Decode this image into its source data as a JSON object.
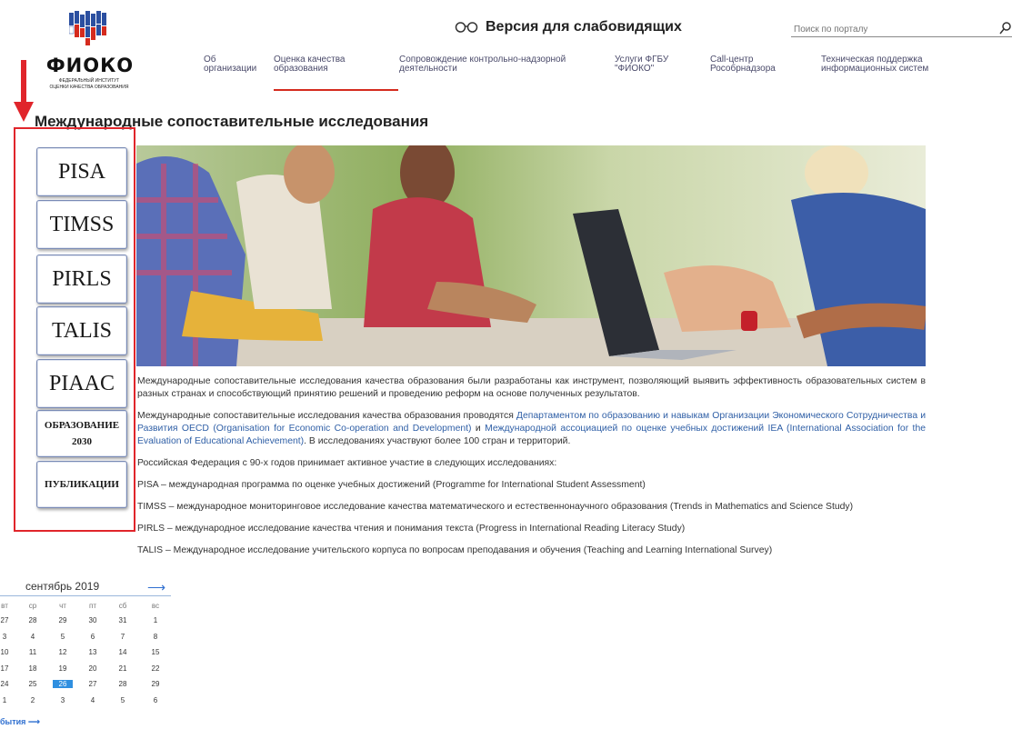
{
  "logo": {
    "name": "ФИОКО",
    "subtitle_line1": "Федеральный институт",
    "subtitle_line2": "оценки качества образования"
  },
  "header": {
    "vision_label": "Версия для слабовидящих",
    "search_placeholder": "Поиск по порталу"
  },
  "nav": [
    {
      "line1": "Об",
      "line2": "организации"
    },
    {
      "line1": "Оценка качества",
      "line2": "образования"
    },
    {
      "line1": "Сопровождение контрольно-надзорной",
      "line2": "деятельности"
    },
    {
      "line1": "Услуги ФГБУ",
      "line2": "\"ФИОКО\""
    },
    {
      "line1": "Call-центр",
      "line2": "Рособрнадзора"
    },
    {
      "line1": "Техническая поддержка",
      "line2": "информационных систем"
    }
  ],
  "page": {
    "title": "Международные сопоставительные исследования"
  },
  "sidebar": {
    "buttons": [
      {
        "label": "PISA"
      },
      {
        "label": "TIMSS"
      },
      {
        "label": "PIRLS"
      },
      {
        "label": "TALIS"
      },
      {
        "label": "PIAAC"
      },
      {
        "line1": "ОБРАЗОВАНИЕ",
        "line2": "2030"
      },
      {
        "label": "ПУБЛИКАЦИИ"
      }
    ]
  },
  "content": {
    "p1": "Международные сопоставительные исследования качества образования были разработаны как инструмент, позволяющий выявить эффективность образовательных систем в разных странах и способствующий принятию решений и проведению реформ на основе полученных результатов.",
    "p2_start": "Международные сопоставительные исследования качества образования проводятся ",
    "p2_link1": "Департаментом по образованию и навыкам Организации Экономического Сотрудничества и Развития OECD (Organisation for Economic Co-operation and Development)",
    "p2_mid": " и ",
    "p2_link2": "Международной ассоциацией по оценке учебных достижений IEA (International Association for the Evaluation of Educational Achievement)",
    "p2_end": ". В исследованиях участвуют более 100 стран и территорий.",
    "p3": "Российская Федерация с 90-х годов принимает активное участие в следующих исследованиях:",
    "list": [
      "PISA – международная программа по оценке учебных достижений (Programme for International Student Assessment)",
      "TIMSS – международное мониторинговое исследование качества математического и естественнонаучного образования (Trends in Mathematics and Science Study)",
      "PIRLS – международное исследование качества чтения и понимания текста (Progress in International Reading Literacy Study)",
      "TALIS – Международное исследование учительского корпуса по вопросам преподавания и обучения (Teaching and Learning International Survey)"
    ]
  },
  "calendar": {
    "month": "сентябрь 2019",
    "next_arrow": "⟶",
    "dow": [
      "вт",
      "ср",
      "чт",
      "пт",
      "сб",
      "вс"
    ],
    "weeks": [
      [
        "27",
        "28",
        "29",
        "30",
        "31",
        "1"
      ],
      [
        "3",
        "4",
        "5",
        "6",
        "7",
        "8"
      ],
      [
        "10",
        "11",
        "12",
        "13",
        "14",
        "15"
      ],
      [
        "17",
        "18",
        "19",
        "20",
        "21",
        "22"
      ],
      [
        "24",
        "25",
        "26",
        "27",
        "28",
        "29"
      ],
      [
        "1",
        "2",
        "3",
        "4",
        "5",
        "6"
      ]
    ],
    "today": "26",
    "events_link": "бытия ⟶"
  },
  "colors": {
    "accent_red": "#d52b1e",
    "link_blue": "#2f5fa6",
    "calendar_blue": "#2f8fe0"
  }
}
